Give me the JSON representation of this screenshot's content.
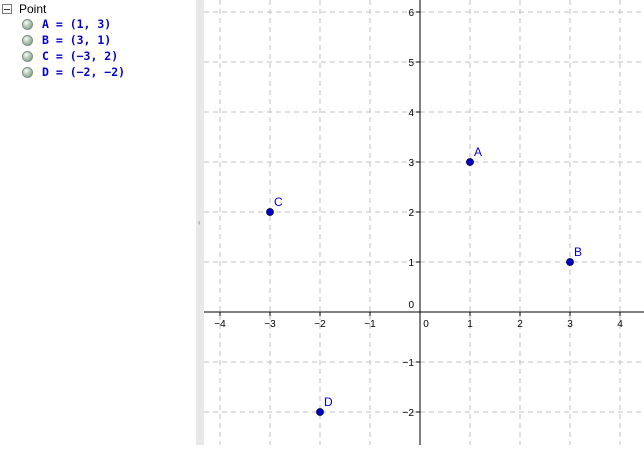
{
  "algebra_view": {
    "group_title": "Point",
    "items": [
      {
        "label": "A = (1, 3)"
      },
      {
        "label": "B = (3, 1)"
      },
      {
        "label": "C = (−3, 2)"
      },
      {
        "label": "D = (−2, −2)"
      }
    ]
  },
  "graphics_view": {
    "x_ticks": [
      {
        "v": -4,
        "label": "−4"
      },
      {
        "v": -3,
        "label": "−3"
      },
      {
        "v": -2,
        "label": "−2"
      },
      {
        "v": -1,
        "label": "−1"
      },
      {
        "v": 0,
        "label": "0"
      },
      {
        "v": 1,
        "label": "1"
      },
      {
        "v": 2,
        "label": "2"
      },
      {
        "v": 3,
        "label": "3"
      },
      {
        "v": 4,
        "label": "4"
      }
    ],
    "y_ticks": [
      {
        "v": -2,
        "label": "−2"
      },
      {
        "v": -1,
        "label": "−1"
      },
      {
        "v": 0,
        "label": "0"
      },
      {
        "v": 1,
        "label": "1"
      },
      {
        "v": 2,
        "label": "2"
      },
      {
        "v": 3,
        "label": "3"
      },
      {
        "v": 4,
        "label": "4"
      },
      {
        "v": 5,
        "label": "5"
      },
      {
        "v": 6,
        "label": "6"
      }
    ],
    "points": [
      {
        "name": "A",
        "x": 1,
        "y": 3
      },
      {
        "name": "B",
        "x": 3,
        "y": 1
      },
      {
        "name": "C",
        "x": -3,
        "y": 2
      },
      {
        "name": "D",
        "x": -2,
        "y": -2
      }
    ],
    "colors": {
      "point": "#0000cc",
      "grid": "#c0c0c0",
      "axis": "#000000"
    }
  }
}
